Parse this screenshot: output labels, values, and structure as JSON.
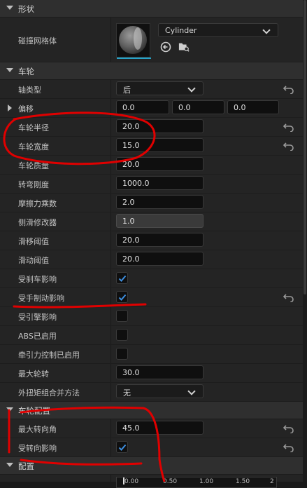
{
  "sections": {
    "shape": "形状",
    "wheel": "车轮",
    "wheel_setup": "车轮配置",
    "config": "配置"
  },
  "shape": {
    "collision_mesh_label": "碰撞网格体",
    "mesh_value": "Cylinder"
  },
  "wheel": {
    "axle_type_label": "轴类型",
    "axle_type_value": "后",
    "offset_label": "偏移",
    "offset_x": "0.0",
    "offset_y": "0.0",
    "offset_z": "0.0",
    "radius_label": "车轮半径",
    "radius_value": "20.0",
    "width_label": "车轮宽度",
    "width_value": "15.0",
    "mass_label": "车轮质量",
    "mass_value": "20.0",
    "cornering_stiffness_label": "转弯刚度",
    "cornering_stiffness_value": "1000.0",
    "friction_label": "摩擦力乘数",
    "friction_value": "2.0",
    "side_slip_label": "侧滑修改器",
    "side_slip_value": "1.0",
    "slip_threshold_label": "滑移阈值",
    "slip_threshold_value": "20.0",
    "skid_threshold_label": "滑动阈值",
    "skid_threshold_value": "20.0",
    "affected_by_brake_label": "受刹车影响",
    "affected_by_brake_checked": true,
    "affected_by_handbrake_label": "受手制动影响",
    "affected_by_handbrake_checked": true,
    "affected_by_engine_label": "受引擎影响",
    "affected_by_engine_checked": false,
    "abs_label": "ABS已启用",
    "abs_checked": false,
    "traction_label": "牵引力控制已启用",
    "traction_checked": false,
    "max_wheelspin_label": "最大轮转",
    "max_wheelspin_value": "30.0",
    "torque_combine_label": "外扭矩组合并方法",
    "torque_combine_value": "无"
  },
  "wheel_setup": {
    "max_steer_label": "最大转向角",
    "max_steer_value": "45.0",
    "affected_by_steering_label": "受转向影响",
    "affected_by_steering_checked": true
  },
  "config": {
    "curve_ticks": [
      "0.00",
      "0.50",
      "1.00",
      "1.50",
      "2"
    ]
  },
  "colors": {
    "panel_bg": "#242424",
    "section_bg": "#2f2f2f",
    "field_bg": "#0f0f0f",
    "check_accent": "#3d8fe0",
    "thumb_accent": "#26a3c9",
    "annotation_red": "#e00000"
  },
  "icons": {
    "section_chevron": "chevron-down-icon",
    "reset": "reset-arrow-icon",
    "browse": "browse-arrow-icon",
    "find": "find-in-content-icon",
    "checkmark": "checkmark-icon"
  }
}
